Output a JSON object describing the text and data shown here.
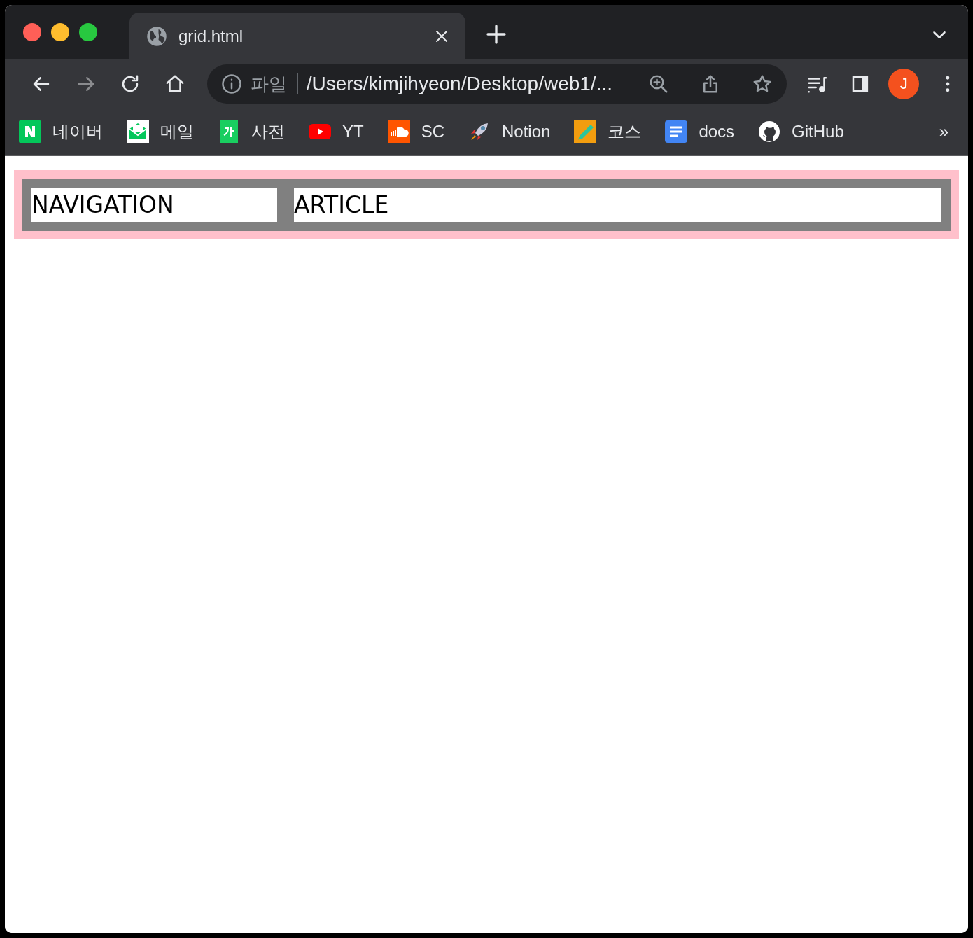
{
  "tab": {
    "title": "grid.html"
  },
  "address": {
    "scheme": "파일",
    "url": "/Users/kimjihyeon/Desktop/web1/..."
  },
  "profile": {
    "initial": "J"
  },
  "bookmarks": [
    {
      "label": "네이버",
      "kind": "naver"
    },
    {
      "label": "메일",
      "kind": "mail"
    },
    {
      "label": "사전",
      "kind": "dict"
    },
    {
      "label": "YT",
      "kind": "youtube"
    },
    {
      "label": "SC",
      "kind": "soundcloud"
    },
    {
      "label": "Notion",
      "kind": "rocket"
    },
    {
      "label": "코스",
      "kind": "pencil"
    },
    {
      "label": "docs",
      "kind": "docs"
    },
    {
      "label": "GitHub",
      "kind": "github"
    }
  ],
  "bookmarks_more": "»",
  "page": {
    "cells": [
      {
        "text": "NAVIGATION"
      },
      {
        "text": "ARTICLE"
      }
    ]
  }
}
